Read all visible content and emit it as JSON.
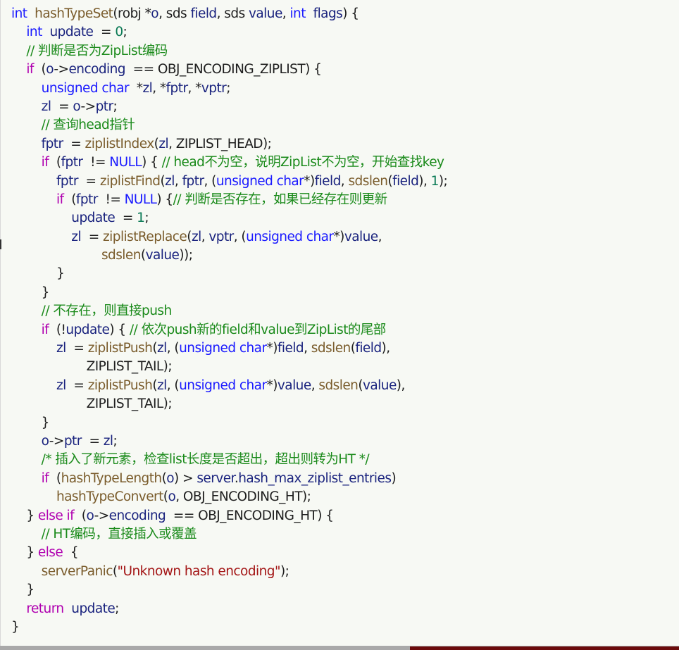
{
  "code": {
    "language": "c",
    "lines": [
      [
        [
          "kw",
          "int"
        ],
        [
          "p",
          " "
        ],
        [
          "fn",
          "hashTypeSet"
        ],
        [
          "p",
          "(robj *"
        ],
        [
          "var",
          "o"
        ],
        [
          "p",
          ", sds "
        ],
        [
          "var",
          "field"
        ],
        [
          "p",
          ", sds "
        ],
        [
          "var",
          "value"
        ],
        [
          "p",
          ", "
        ],
        [
          "kw",
          "int"
        ],
        [
          "p",
          " "
        ],
        [
          "var",
          "flags"
        ],
        [
          "p",
          ") {"
        ]
      ],
      [
        [
          "p",
          "  "
        ],
        [
          "kw",
          "int"
        ],
        [
          "p",
          " "
        ],
        [
          "var",
          "update"
        ],
        [
          "p",
          " = "
        ],
        [
          "num",
          "0"
        ],
        [
          "p",
          ";"
        ]
      ],
      [
        [
          "p",
          "  "
        ],
        [
          "cm",
          "// 判断是否为ZipList编码"
        ]
      ],
      [
        [
          "p",
          "  "
        ],
        [
          "ctl",
          "if"
        ],
        [
          "p",
          " ("
        ],
        [
          "var",
          "o"
        ],
        [
          "p",
          "->"
        ],
        [
          "var",
          "encoding"
        ],
        [
          "p",
          " == "
        ],
        [
          "mac",
          "OBJ_ENCODING_ZIPLIST"
        ],
        [
          "p",
          ") {"
        ]
      ],
      [
        [
          "p",
          "    "
        ],
        [
          "kw",
          "unsigned char"
        ],
        [
          "p",
          " *"
        ],
        [
          "var",
          "zl"
        ],
        [
          "p",
          ", *"
        ],
        [
          "var",
          "fptr"
        ],
        [
          "p",
          ", *"
        ],
        [
          "var",
          "vptr"
        ],
        [
          "p",
          ";"
        ]
      ],
      [
        [
          "p",
          "    "
        ],
        [
          "var",
          "zl"
        ],
        [
          "p",
          " = "
        ],
        [
          "var",
          "o"
        ],
        [
          "p",
          "->"
        ],
        [
          "var",
          "ptr"
        ],
        [
          "p",
          ";"
        ]
      ],
      [
        [
          "p",
          "    "
        ],
        [
          "cm",
          "// 查询head指针"
        ]
      ],
      [
        [
          "p",
          "    "
        ],
        [
          "var",
          "fptr"
        ],
        [
          "p",
          " = "
        ],
        [
          "fn",
          "ziplistIndex"
        ],
        [
          "p",
          "("
        ],
        [
          "var",
          "zl"
        ],
        [
          "p",
          ", "
        ],
        [
          "mac",
          "ZIPLIST_HEAD"
        ],
        [
          "p",
          ");"
        ]
      ],
      [
        [
          "p",
          "    "
        ],
        [
          "ctl",
          "if"
        ],
        [
          "p",
          " ("
        ],
        [
          "var",
          "fptr"
        ],
        [
          "p",
          " != "
        ],
        [
          "nul",
          "NULL"
        ],
        [
          "p",
          ") { "
        ],
        [
          "cm",
          "// head不为空，说明ZipList不为空，开始查找key"
        ]
      ],
      [
        [
          "p",
          "      "
        ],
        [
          "var",
          "fptr"
        ],
        [
          "p",
          " = "
        ],
        [
          "fn",
          "ziplistFind"
        ],
        [
          "p",
          "("
        ],
        [
          "var",
          "zl"
        ],
        [
          "p",
          ", "
        ],
        [
          "var",
          "fptr"
        ],
        [
          "p",
          ", ("
        ],
        [
          "kw",
          "unsigned char"
        ],
        [
          "p",
          "*)"
        ],
        [
          "var",
          "field"
        ],
        [
          "p",
          ", "
        ],
        [
          "fn",
          "sdslen"
        ],
        [
          "p",
          "("
        ],
        [
          "var",
          "field"
        ],
        [
          "p",
          "), "
        ],
        [
          "num",
          "1"
        ],
        [
          "p",
          ");"
        ]
      ],
      [
        [
          "p",
          "      "
        ],
        [
          "ctl",
          "if"
        ],
        [
          "p",
          " ("
        ],
        [
          "var",
          "fptr"
        ],
        [
          "p",
          " != "
        ],
        [
          "nul",
          "NULL"
        ],
        [
          "p",
          ") {"
        ],
        [
          "cm",
          "// 判断是否存在，如果已经存在则更新"
        ]
      ],
      [
        [
          "p",
          "        "
        ],
        [
          "var",
          "update"
        ],
        [
          "p",
          " = "
        ],
        [
          "num",
          "1"
        ],
        [
          "p",
          ";"
        ]
      ],
      [
        [
          "p",
          "        "
        ],
        [
          "var",
          "zl"
        ],
        [
          "p",
          " = "
        ],
        [
          "fn",
          "ziplistReplace"
        ],
        [
          "p",
          "("
        ],
        [
          "var",
          "zl"
        ],
        [
          "p",
          ", "
        ],
        [
          "var",
          "vptr"
        ],
        [
          "p",
          ", ("
        ],
        [
          "kw",
          "unsigned char"
        ],
        [
          "p",
          "*)"
        ],
        [
          "var",
          "value"
        ],
        [
          "p",
          ","
        ]
      ],
      [
        [
          "p",
          "            "
        ],
        [
          "fn",
          "sdslen"
        ],
        [
          "p",
          "("
        ],
        [
          "var",
          "value"
        ],
        [
          "p",
          "));"
        ]
      ],
      [
        [
          "p",
          "      }"
        ]
      ],
      [
        [
          "p",
          "    }"
        ]
      ],
      [
        [
          "p",
          "    "
        ],
        [
          "cm",
          "// 不存在，则直接push"
        ]
      ],
      [
        [
          "p",
          "    "
        ],
        [
          "ctl",
          "if"
        ],
        [
          "p",
          " (!"
        ],
        [
          "var",
          "update"
        ],
        [
          "p",
          ") { "
        ],
        [
          "cm",
          "// 依次push新的field和value到ZipList的尾部"
        ]
      ],
      [
        [
          "p",
          "      "
        ],
        [
          "var",
          "zl"
        ],
        [
          "p",
          " = "
        ],
        [
          "fn",
          "ziplistPush"
        ],
        [
          "p",
          "("
        ],
        [
          "var",
          "zl"
        ],
        [
          "p",
          ", ("
        ],
        [
          "kw",
          "unsigned char"
        ],
        [
          "p",
          "*)"
        ],
        [
          "var",
          "field"
        ],
        [
          "p",
          ", "
        ],
        [
          "fn",
          "sdslen"
        ],
        [
          "p",
          "("
        ],
        [
          "var",
          "field"
        ],
        [
          "p",
          "),"
        ]
      ],
      [
        [
          "p",
          "          "
        ],
        [
          "mac",
          "ZIPLIST_TAIL"
        ],
        [
          "p",
          ");"
        ]
      ],
      [
        [
          "p",
          "      "
        ],
        [
          "var",
          "zl"
        ],
        [
          "p",
          " = "
        ],
        [
          "fn",
          "ziplistPush"
        ],
        [
          "p",
          "("
        ],
        [
          "var",
          "zl"
        ],
        [
          "p",
          ", ("
        ],
        [
          "kw",
          "unsigned char"
        ],
        [
          "p",
          "*)"
        ],
        [
          "var",
          "value"
        ],
        [
          "p",
          ", "
        ],
        [
          "fn",
          "sdslen"
        ],
        [
          "p",
          "("
        ],
        [
          "var",
          "value"
        ],
        [
          "p",
          "),"
        ]
      ],
      [
        [
          "p",
          "          "
        ],
        [
          "mac",
          "ZIPLIST_TAIL"
        ],
        [
          "p",
          ");"
        ]
      ],
      [
        [
          "p",
          "    }"
        ]
      ],
      [
        [
          "p",
          "    "
        ],
        [
          "var",
          "o"
        ],
        [
          "p",
          "->"
        ],
        [
          "var",
          "ptr"
        ],
        [
          "p",
          " = "
        ],
        [
          "var",
          "zl"
        ],
        [
          "p",
          ";"
        ]
      ],
      [
        [
          "p",
          "    "
        ],
        [
          "cm",
          "/* 插入了新元素，检查list长度是否超出，超出则转为HT */"
        ]
      ],
      [
        [
          "p",
          "    "
        ],
        [
          "ctl",
          "if"
        ],
        [
          "p",
          " ("
        ],
        [
          "fn",
          "hashTypeLength"
        ],
        [
          "p",
          "("
        ],
        [
          "var",
          "o"
        ],
        [
          "p",
          ") > "
        ],
        [
          "var",
          "server"
        ],
        [
          "p",
          "."
        ],
        [
          "var",
          "hash_max_ziplist_entries"
        ],
        [
          "p",
          ")"
        ]
      ],
      [
        [
          "p",
          "      "
        ],
        [
          "fn",
          "hashTypeConvert"
        ],
        [
          "p",
          "("
        ],
        [
          "var",
          "o"
        ],
        [
          "p",
          ", "
        ],
        [
          "mac",
          "OBJ_ENCODING_HT"
        ],
        [
          "p",
          ");"
        ]
      ],
      [
        [
          "p",
          "  } "
        ],
        [
          "ctl",
          "else if"
        ],
        [
          "p",
          " ("
        ],
        [
          "var",
          "o"
        ],
        [
          "p",
          "->"
        ],
        [
          "var",
          "encoding"
        ],
        [
          "p",
          " == "
        ],
        [
          "mac",
          "OBJ_ENCODING_HT"
        ],
        [
          "p",
          ") {"
        ]
      ],
      [
        [
          "p",
          "    "
        ],
        [
          "cm",
          "// HT编码，直接插入或覆盖"
        ]
      ],
      [
        [
          "p",
          "  } "
        ],
        [
          "ctl",
          "else"
        ],
        [
          "p",
          " {"
        ]
      ],
      [
        [
          "p",
          "    "
        ],
        [
          "fn",
          "serverPanic"
        ],
        [
          "p",
          "("
        ],
        [
          "str",
          "\"Unknown hash encoding\""
        ],
        [
          "p",
          ");"
        ]
      ],
      [
        [
          "p",
          "  }"
        ]
      ],
      [
        [
          "p",
          "  "
        ],
        [
          "ctl",
          "return"
        ],
        [
          "p",
          " "
        ],
        [
          "var",
          "update"
        ],
        [
          "p",
          ";"
        ]
      ],
      [
        [
          "p",
          "}"
        ]
      ]
    ]
  }
}
